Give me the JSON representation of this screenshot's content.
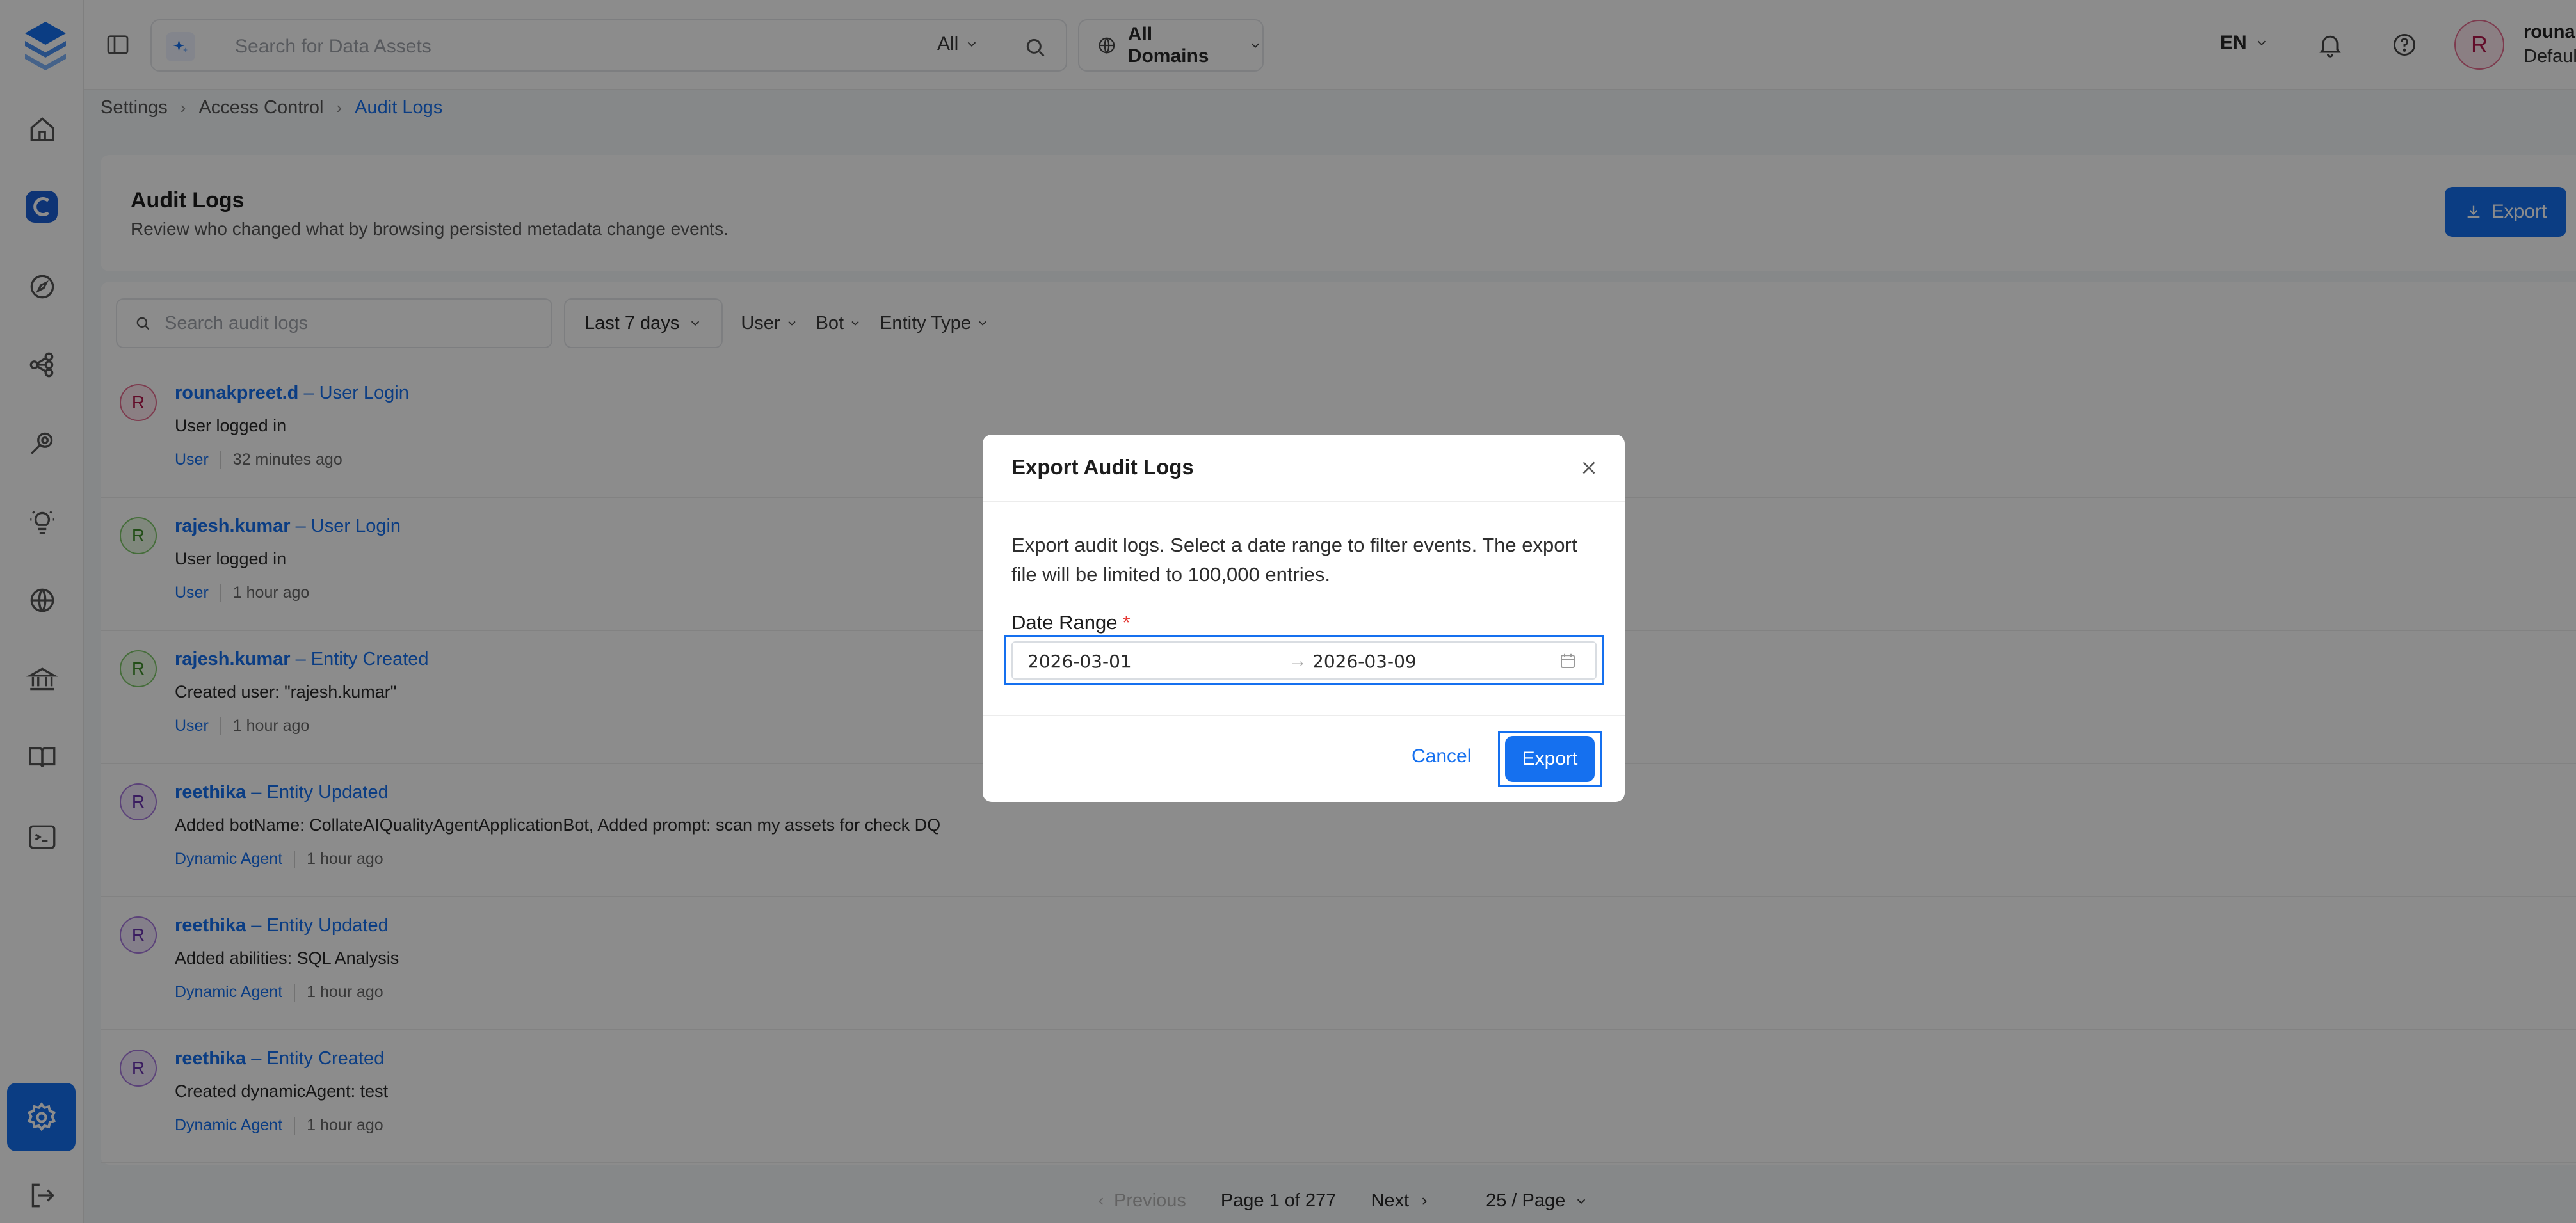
{
  "topbar": {
    "search_placeholder": "Search for Data Assets",
    "search_scope": "All",
    "domain_label": "All Domains",
    "language": "EN",
    "user_name": "rounakpreet.d",
    "user_role": "Default",
    "avatar_letter": "R"
  },
  "breadcrumb": [
    "Settings",
    "Access Control",
    "Audit Logs"
  ],
  "header": {
    "title": "Audit Logs",
    "subtitle": "Review who changed what by browsing persisted metadata change events.",
    "export_label": "Export"
  },
  "filters": {
    "search_placeholder": "Search audit logs",
    "date_range": "Last 7 days",
    "user": "User",
    "bot": "Bot",
    "entity_type": "Entity Type"
  },
  "logs": [
    {
      "letter": "R",
      "user": "rounakpreet.d",
      "action": "– User Login",
      "description": "User logged in",
      "entity_type": "User",
      "time": "32 minutes ago",
      "bg": "#fde7ee",
      "border": "#e46c8f",
      "fg": "#b3174b"
    },
    {
      "letter": "R",
      "user": "rajesh.kumar",
      "action": "– User Login",
      "description": "User logged in",
      "entity_type": "User",
      "time": "1 hour ago",
      "bg": "#eaf7e4",
      "border": "#7fc76a",
      "fg": "#3f8f2a"
    },
    {
      "letter": "R",
      "user": "rajesh.kumar",
      "action": "– Entity Created",
      "description": "Created user: \"rajesh.kumar\"",
      "entity_type": "User",
      "time": "1 hour ago",
      "bg": "#eaf7e4",
      "border": "#7fc76a",
      "fg": "#3f8f2a"
    },
    {
      "letter": "R",
      "user": "reethika",
      "action": "– Entity Updated",
      "description": "Added botName: CollateAIQualityAgentApplicationBot, Added prompt: scan my assets for check DQ",
      "entity_type": "Dynamic Agent",
      "time": "1 hour ago",
      "bg": "#f1e8fb",
      "border": "#a778dd",
      "fg": "#6b34b0"
    },
    {
      "letter": "R",
      "user": "reethika",
      "action": "– Entity Updated",
      "description": "Added abilities: SQL Analysis",
      "entity_type": "Dynamic Agent",
      "time": "1 hour ago",
      "bg": "#f1e8fb",
      "border": "#a778dd",
      "fg": "#6b34b0"
    },
    {
      "letter": "R",
      "user": "reethika",
      "action": "– Entity Created",
      "description": "Created dynamicAgent: test",
      "entity_type": "Dynamic Agent",
      "time": "1 hour ago",
      "bg": "#f1e8fb",
      "border": "#a778dd",
      "fg": "#6b34b0"
    }
  ],
  "pagination": {
    "previous": "Previous",
    "page_info": "Page 1 of 277",
    "next": "Next",
    "page_size": "25 / Page"
  },
  "modal": {
    "title": "Export Audit Logs",
    "description": "Export audit logs. Select a date range to filter events. The export file will be limited to 100,000 entries.",
    "date_label": "Date Range",
    "required_mark": "*",
    "start_date": "2026-03-01",
    "end_date": "2026-03-09",
    "cancel_label": "Cancel",
    "export_label": "Export"
  },
  "colors": {
    "primary": "#1570ef",
    "brand": "#1b5fd6",
    "overlay": "rgba(0,0,0,0.45)"
  }
}
